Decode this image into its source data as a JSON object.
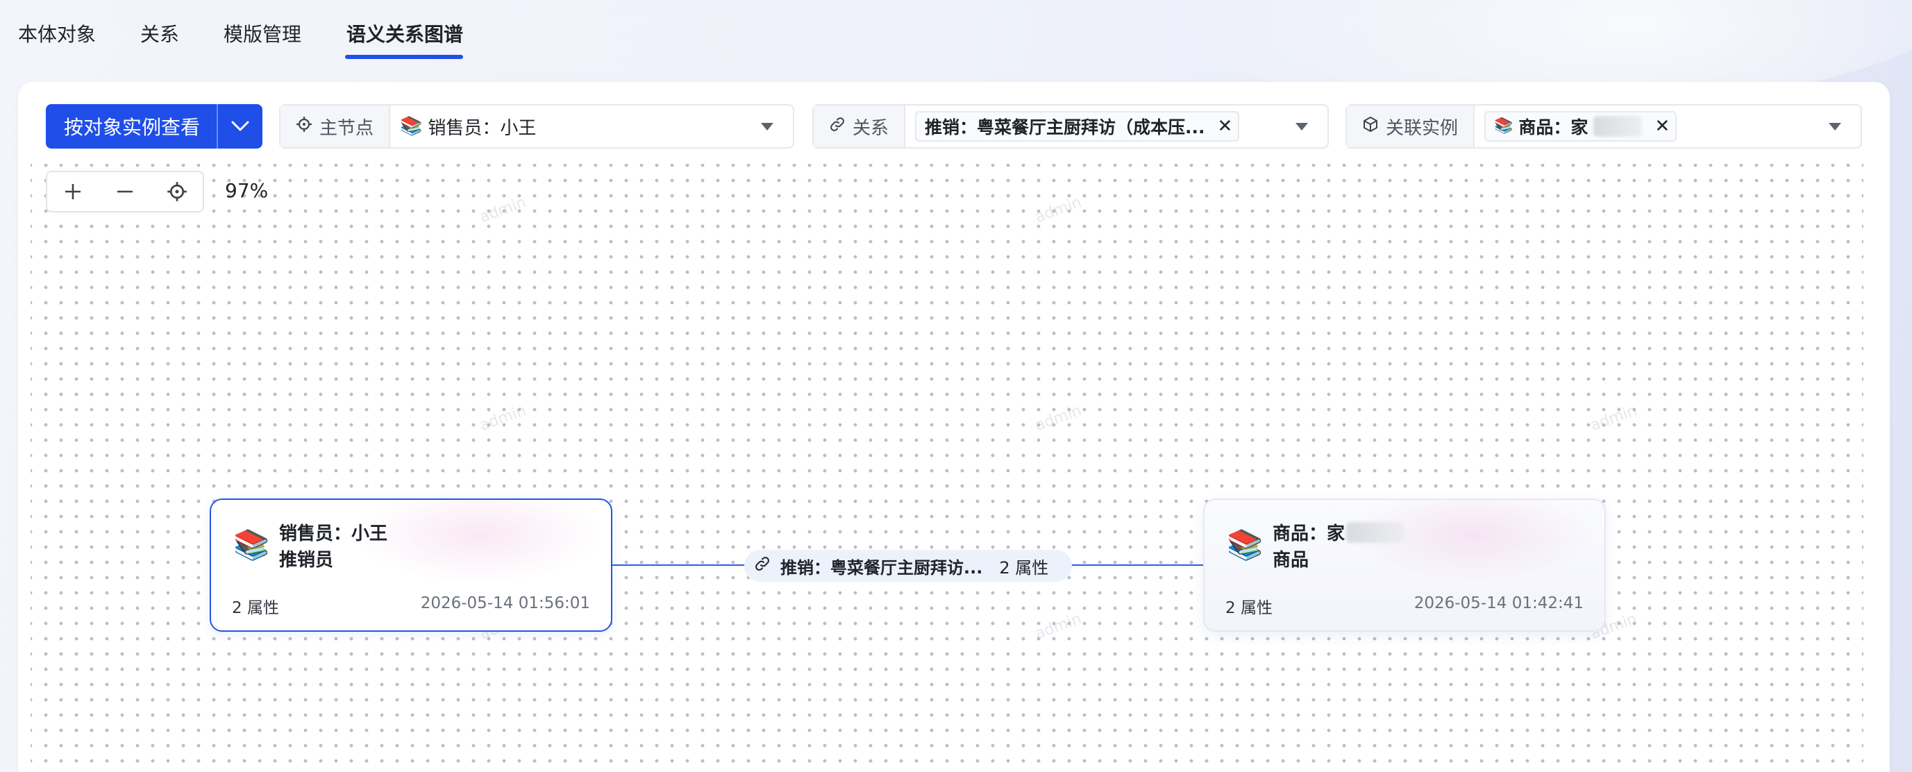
{
  "tabs": [
    {
      "label": "本体对象"
    },
    {
      "label": "关系"
    },
    {
      "label": "模版管理"
    },
    {
      "label": "语义关系图谱",
      "active": true
    }
  ],
  "toolbar": {
    "view_mode_button": "按对象实例查看",
    "main_node_filter": {
      "prefix": "主节点",
      "value": "销售员：小王"
    },
    "relation_filter": {
      "prefix": "关系",
      "tag": "推销：粤菜餐厅主厨拜访（成本压..."
    },
    "related_instance_filter": {
      "prefix": "关联实例",
      "tag": "商品：家"
    }
  },
  "zoom": {
    "level": "97%"
  },
  "graph": {
    "source_node": {
      "title": "销售员：小王",
      "type": "推销员",
      "attrs": "2 属性",
      "timestamp": "2026-05-14 01:56:01",
      "selected": true
    },
    "edge": {
      "label": "推销：粤菜餐厅主厨拜访...",
      "attrs": "2  属性"
    },
    "target_node": {
      "title": "商品：家",
      "type": "商品",
      "attrs": "2 属性",
      "timestamp": "2026-05-14 01:42:41",
      "selected": false
    }
  },
  "watermark": "admin",
  "colors": {
    "primary": "#1f4ee8",
    "edge": "#2b5be8",
    "canvas_dot": "#b9bec8"
  }
}
